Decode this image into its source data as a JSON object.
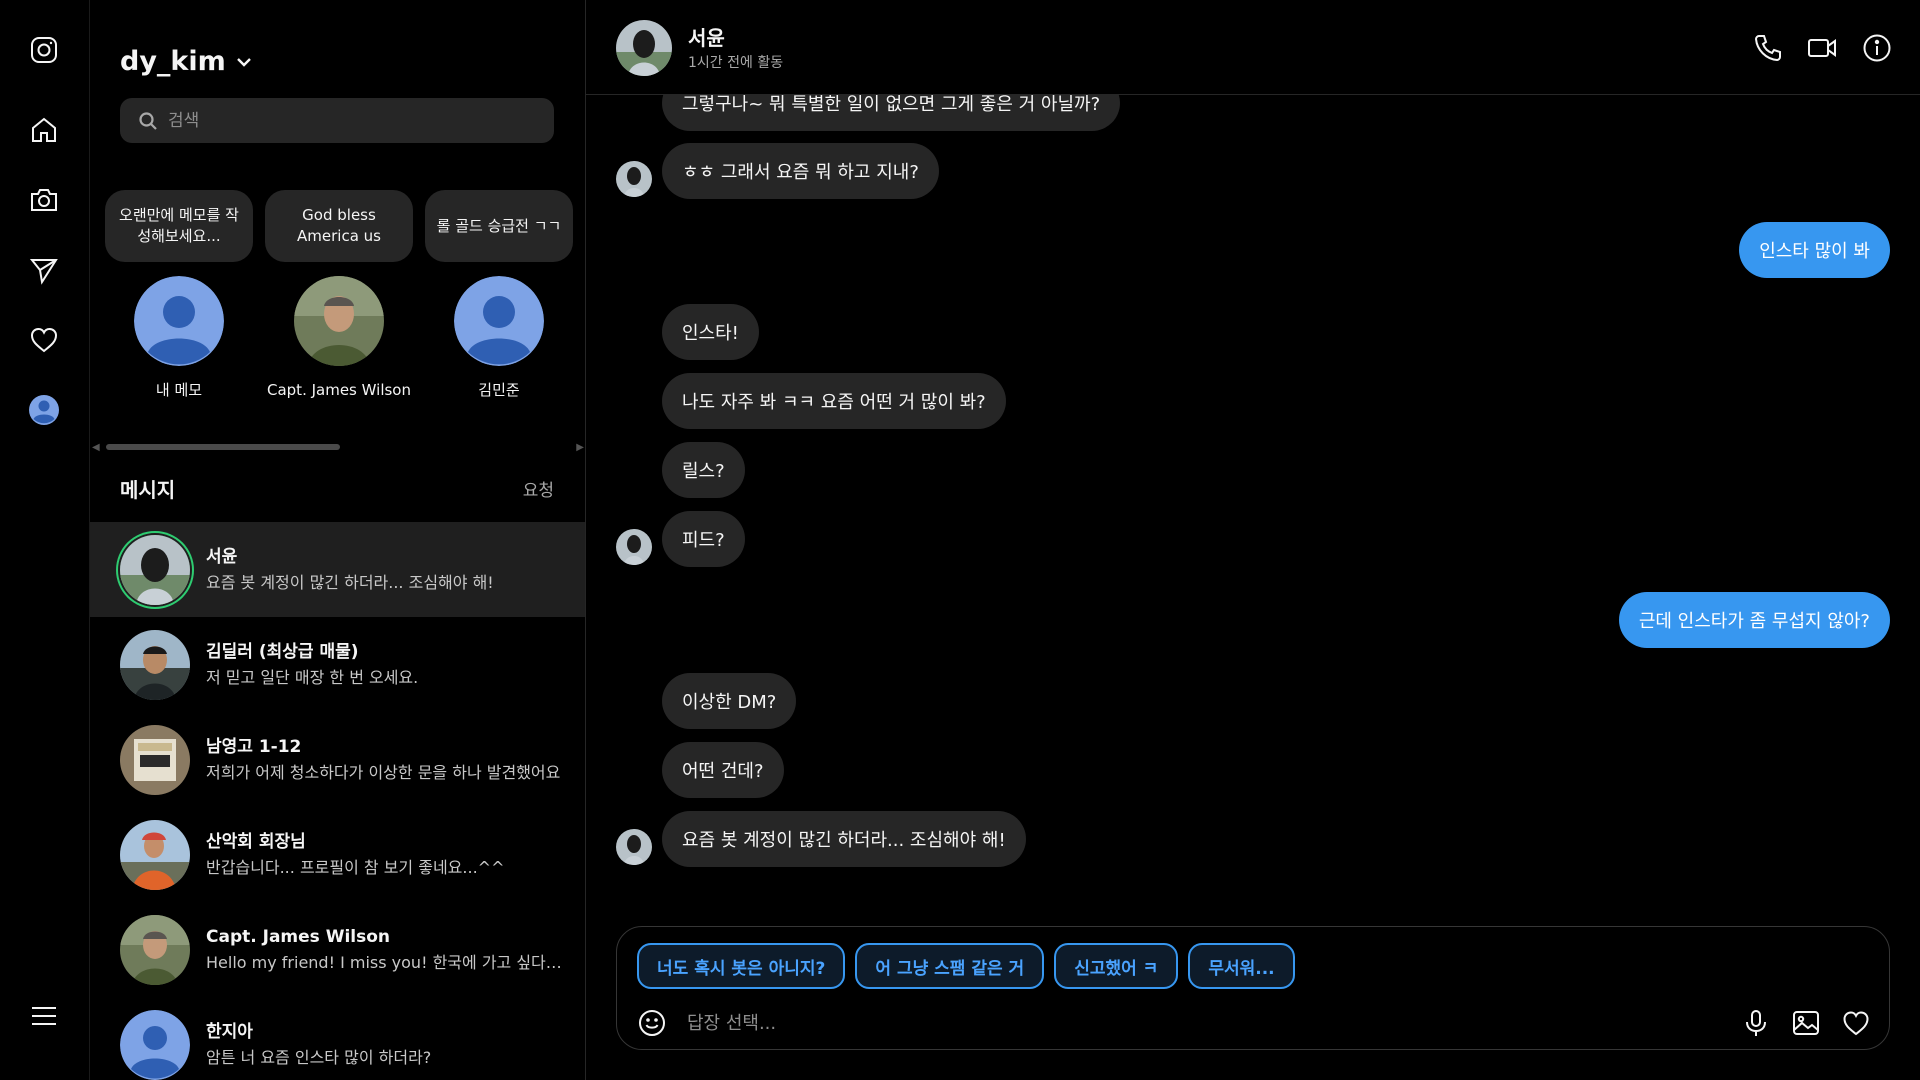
{
  "colors": {
    "accent": "#3797f0",
    "bubble_in": "#262626",
    "active_row": "#1f1f1f",
    "online_ring": "#2ecc71"
  },
  "rail": {
    "icons": [
      "instagram-icon",
      "home-icon",
      "camera-icon",
      "send-icon",
      "heart-icon",
      "profile-avatar",
      "menu-icon"
    ]
  },
  "inbox": {
    "account": "dy_kim",
    "search_placeholder": "검색",
    "notes": [
      {
        "bubble": "오랜만에 메모를 작성해보세요...",
        "name": "내 메모"
      },
      {
        "bubble": "God bless America us",
        "name": "Capt. James Wilson"
      },
      {
        "bubble": "롤 골드 승급전 ㄱㄱ",
        "name": "김민준"
      }
    ],
    "messages_title": "메시지",
    "requests_label": "요청",
    "conversations": [
      {
        "name": "서윤",
        "preview": "요즘 봇 계정이 많긴 하더라... 조심해야 해!",
        "active": true
      },
      {
        "name": "김딜러 (최상급 매물)",
        "preview": "저 믿고 일단 매장 한 번 오세요."
      },
      {
        "name": "남영고 1-12",
        "preview": "저희가 어제 청소하다가 이상한 문을 하나 발견했어요"
      },
      {
        "name": "산악회 회장님",
        "preview": "반갑습니다... 프로필이 참 보기 좋네요...^^"
      },
      {
        "name": "Capt. James Wilson",
        "preview": "Hello my friend! I miss you! 한국에 가고 싶다. 우리 다시"
      },
      {
        "name": "한지아",
        "preview": "암튼 너 요즘 인스타 많이 하더라?"
      }
    ]
  },
  "chat": {
    "name": "서윤",
    "status": "1시간 전에 활동",
    "messages": [
      {
        "dir": "in",
        "text": "그렇구나~ 뭐 특별한 일이 없으면 그게 좋은 거 아닐까?",
        "avatar": false
      },
      {
        "dir": "in",
        "text": "ㅎㅎ 그래서 요즘 뭐 하고 지내?",
        "avatar": true
      },
      {
        "dir": "out",
        "text": "인스타 많이 봐"
      },
      {
        "dir": "in",
        "text": "인스타!",
        "avatar": false
      },
      {
        "dir": "in",
        "text": "나도 자주 봐 ㅋㅋ 요즘 어떤 거 많이 봐?",
        "avatar": false
      },
      {
        "dir": "in",
        "text": "릴스?",
        "avatar": false
      },
      {
        "dir": "in",
        "text": "피드?",
        "avatar": true
      },
      {
        "dir": "out",
        "text": "근데 인스타가 좀 무섭지 않아?"
      },
      {
        "dir": "in",
        "text": "이상한 DM?",
        "avatar": false
      },
      {
        "dir": "in",
        "text": "어떤 건데?",
        "avatar": false
      },
      {
        "dir": "in",
        "text": "요즘 봇 계정이 많긴 하더라... 조심해야 해!",
        "avatar": true
      }
    ],
    "quick_replies": [
      "너도 혹시 봇은 아니지?",
      "어 그냥 스팸 같은 거",
      "신고했어 ㅋ",
      "무서워..."
    ],
    "input_placeholder": "답장 선택..."
  }
}
